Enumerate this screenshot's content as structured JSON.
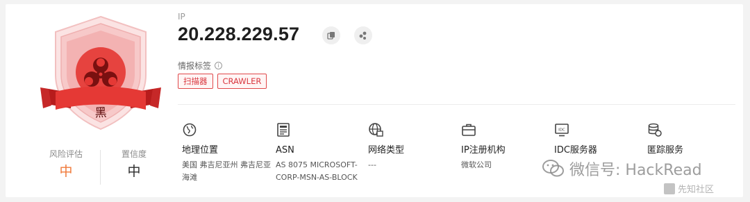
{
  "badge": {
    "label": "黑",
    "colors": {
      "primary": "#e53935",
      "light": "#f7c5c5",
      "dark": "#8e1212"
    }
  },
  "metrics": [
    {
      "label": "风险评估",
      "value": "中"
    },
    {
      "label": "置信度",
      "value": "中"
    }
  ],
  "ip": {
    "caption": "IP",
    "value": "20.228.229.57",
    "copy_icon": "copy-icon",
    "graph_icon": "graph-icon"
  },
  "tags": {
    "caption": "情报标签",
    "info_icon": "info-icon",
    "items": [
      "扫描器",
      "CRAWLER"
    ],
    "color": "#d9363e"
  },
  "attributes": [
    {
      "icon": "globe-icon",
      "title": "地理位置",
      "value": "美国 弗吉尼亚州 弗吉尼亚海滩"
    },
    {
      "icon": "asn-icon",
      "title": "ASN",
      "value": "AS 8075 MICROSOFT-CORP-MSN-AS-BLOCK"
    },
    {
      "icon": "network-icon",
      "title": "网络类型",
      "value": "---"
    },
    {
      "icon": "briefcase-icon",
      "title": "IP注册机构",
      "value": "微软公司"
    },
    {
      "icon": "idc-icon",
      "title": "IDC服务器",
      "value": ""
    },
    {
      "icon": "database-icon",
      "title": "匿踪服务",
      "value": ""
    }
  ],
  "watermark": {
    "main": "微信号: HackRead",
    "sub": "先知社区"
  }
}
